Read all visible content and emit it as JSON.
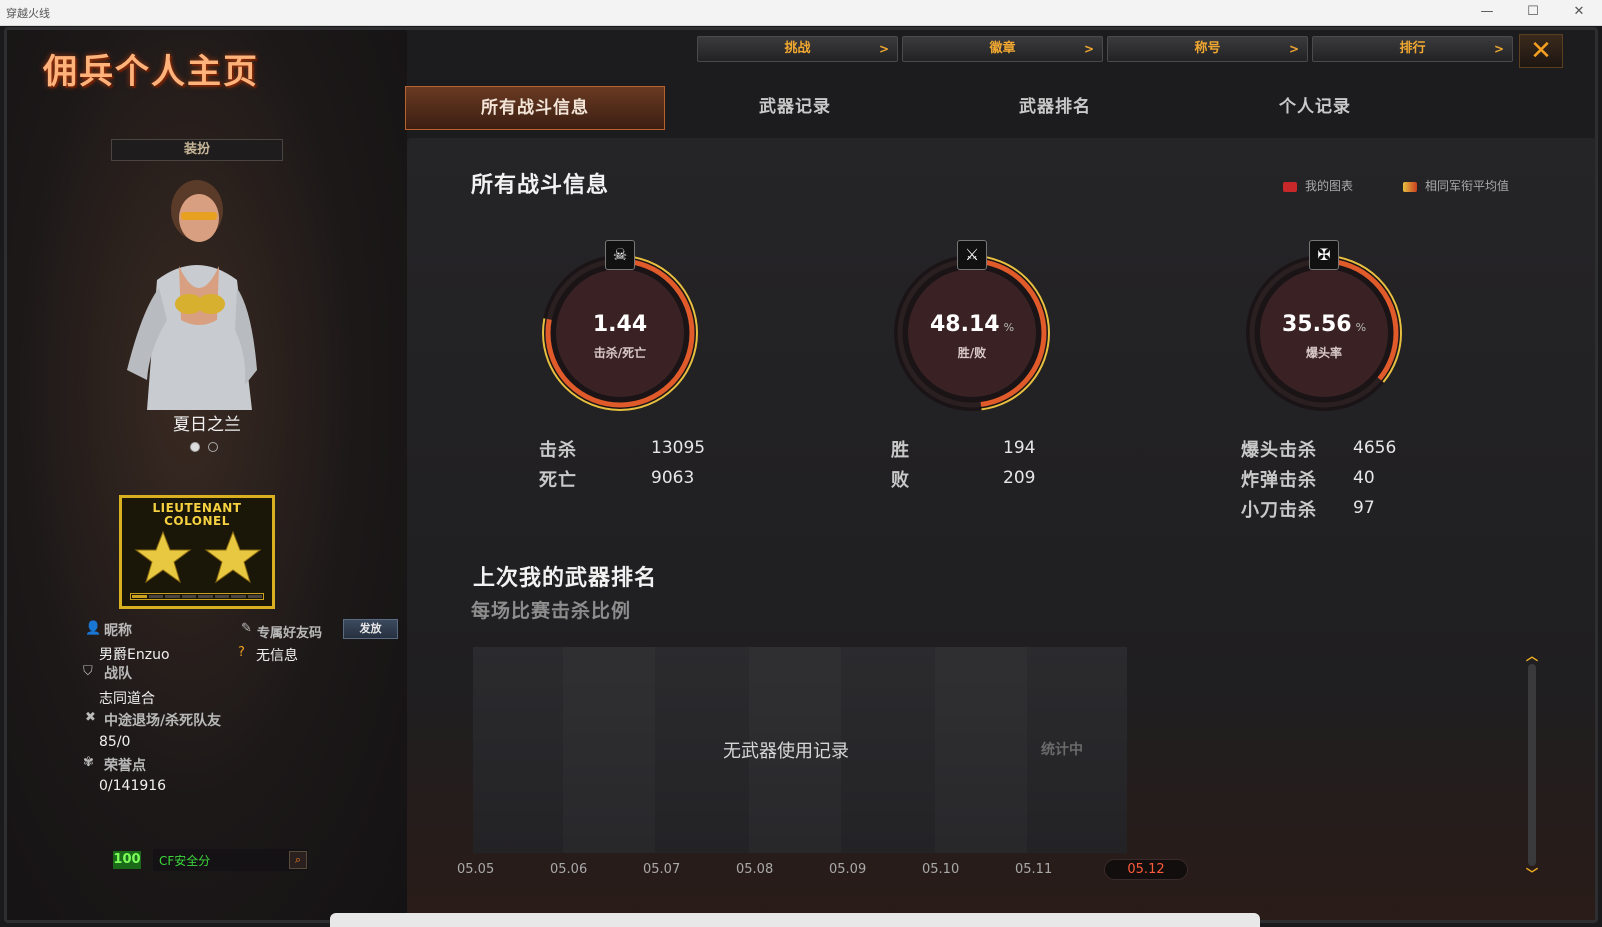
{
  "window": {
    "title": "穿越火线",
    "min": "—",
    "max": "☐",
    "close": "✕"
  },
  "app": {
    "title": "佣兵个人主页"
  },
  "topnav": [
    {
      "label": "挑战",
      "arrow": ">"
    },
    {
      "label": "徽章",
      "arrow": ">"
    },
    {
      "label": "称号",
      "arrow": ">"
    },
    {
      "label": "排行",
      "arrow": ">"
    }
  ],
  "close_label": "✕",
  "tabs": [
    {
      "label": "所有战斗信息",
      "active": true
    },
    {
      "label": "武器记录",
      "active": false
    },
    {
      "label": "武器排名",
      "active": false
    },
    {
      "label": "个人记录",
      "active": false
    }
  ],
  "sidebar": {
    "dress_label": "装扮",
    "character_name": "夏日之兰",
    "rank": {
      "line1": "LIEUTENANT",
      "line2": "COLONEL"
    },
    "nickname_label": "昵称",
    "nickname_value": "男爵Enzuo",
    "friend_code_label": "专属好友码",
    "send_label": "发放",
    "friend_code_value": "无信息",
    "team_label": "战队",
    "team_value": "志同道合",
    "quit_label": "中途退场/杀死队友",
    "quit_value": "85/0",
    "honor_label": "荣誉点",
    "honor_value": "0/141916",
    "safety_score": "100",
    "safety_label": "CF安全分"
  },
  "main": {
    "section_title": "所有战斗信息",
    "legend": [
      {
        "label": "我的图表",
        "color": "#c8282a"
      },
      {
        "label": "相同军衔平均值",
        "color": "#e8c040"
      }
    ],
    "gauges": [
      {
        "value": "1.44",
        "unit": "",
        "label": "击杀/死亡",
        "icon": "skull-crossbones-icon",
        "glyph": "☠",
        "fill": 0.78
      },
      {
        "value": "48.14",
        "unit": "%",
        "label": "胜/败",
        "icon": "crossed-swords-icon",
        "glyph": "⚔",
        "fill": 0.48
      },
      {
        "value": "35.56",
        "unit": "%",
        "label": "爆头率",
        "icon": "crossed-rifles-icon",
        "glyph": "✠",
        "fill": 0.36
      }
    ],
    "stats": {
      "kills_label": "击杀",
      "kills": "13095",
      "deaths_label": "死亡",
      "deaths": "9063",
      "wins_label": "胜",
      "wins": "194",
      "losses_label": "败",
      "losses": "209",
      "headshot_label": "爆头击杀",
      "headshot": "4656",
      "bomb_label": "炸弹击杀",
      "bomb": "40",
      "knife_label": "小刀击杀",
      "knife": "97"
    },
    "weapon_rank_title": "上次我的武器排名",
    "weapon_rank_subtitle": "每场比赛击杀比例",
    "no_record": "无武器使用记录",
    "stat_calc": "统计中",
    "dates": [
      "05.05",
      "05.06",
      "05.07",
      "05.08",
      "05.09",
      "05.10",
      "05.11",
      "05.12"
    ],
    "active_date": "05.12"
  }
}
